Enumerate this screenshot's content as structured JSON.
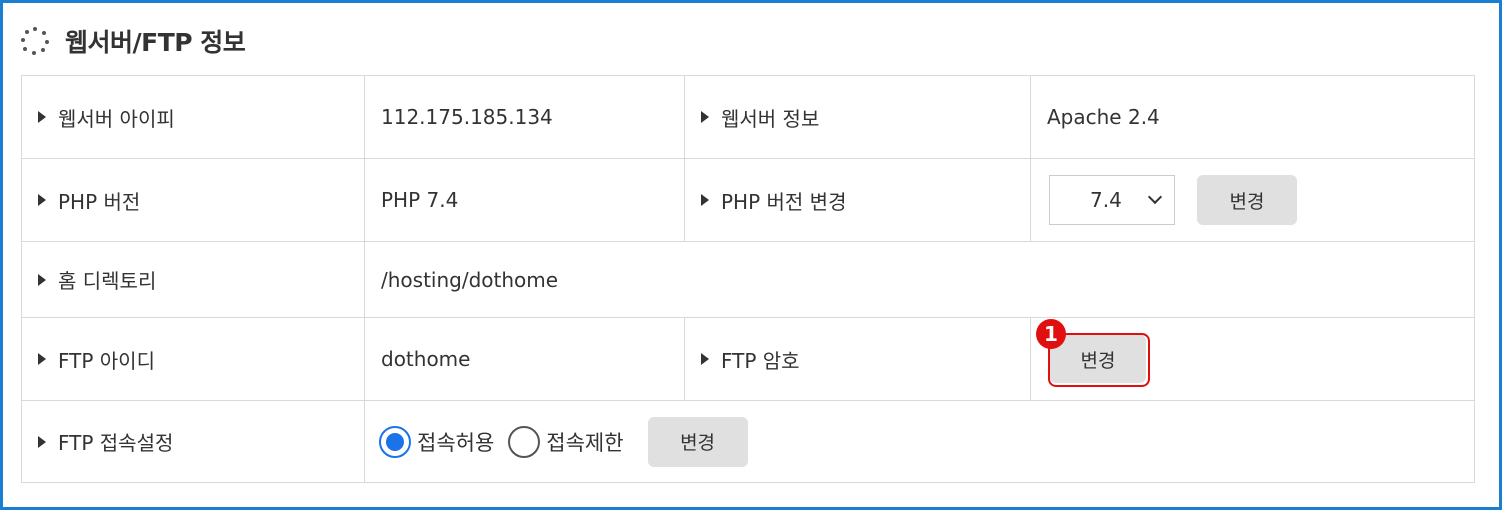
{
  "header": {
    "title": "웹서버/FTP 정보",
    "icon": "loading-icon"
  },
  "rows": {
    "web_ip": {
      "label": "웹서버 아이피",
      "value": "112.175.185.134"
    },
    "web_info": {
      "label": "웹서버 정보",
      "value": "Apache 2.4"
    },
    "php_version": {
      "label": "PHP 버전",
      "value": "PHP 7.4"
    },
    "php_change": {
      "label": "PHP 버전 변경",
      "selected": "7.4",
      "button": "변경"
    },
    "home_dir": {
      "label": "홈 디렉토리",
      "value": "/hosting/dothome"
    },
    "ftp_id": {
      "label": "FTP 아이디",
      "value": "dothome"
    },
    "ftp_pw": {
      "label": "FTP 암호",
      "button": "변경"
    },
    "ftp_access": {
      "label": "FTP 접속설정",
      "option_allow": "접속허용",
      "option_deny": "접속제한",
      "selected": "접속허용",
      "button": "변경"
    }
  },
  "annotation": {
    "marker": "1"
  },
  "colors": {
    "accent": "#1a7fd1",
    "highlight": "#e01010",
    "value_red": "#ff1a1a"
  }
}
